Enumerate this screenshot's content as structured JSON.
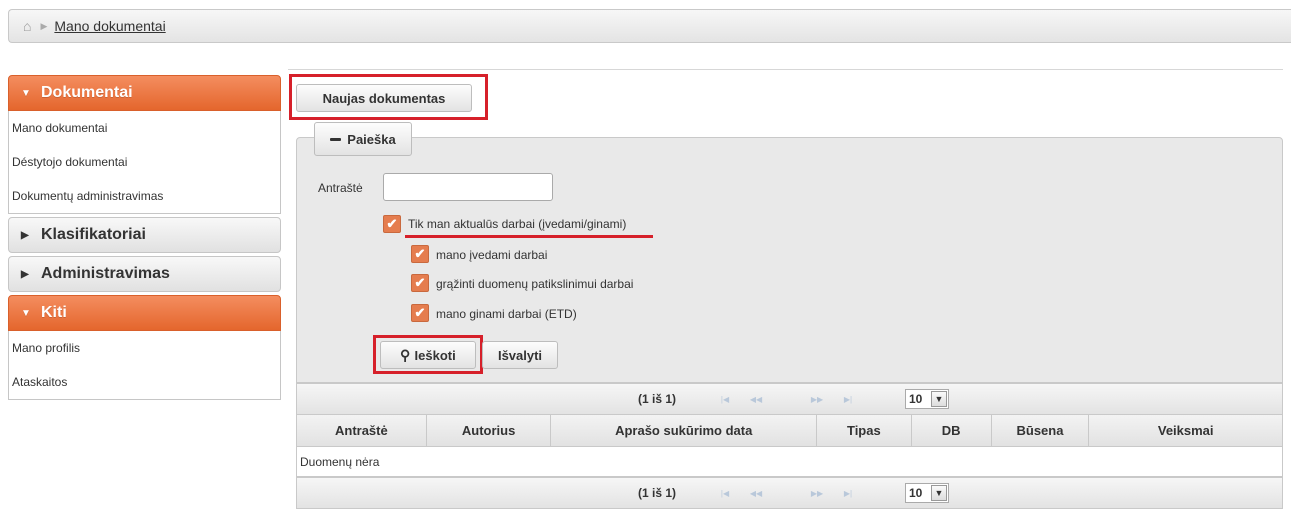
{
  "breadcrumb": {
    "current": "Mano dokumentai"
  },
  "sidebar": {
    "sections": [
      {
        "title": "Dokumentai",
        "items": [
          "Mano dokumentai",
          "Déstytojo dokumentai",
          "Dokumentų administravimas"
        ]
      },
      {
        "title": "Klasifikatoriai"
      },
      {
        "title": "Administravimas"
      },
      {
        "title": "Kiti",
        "items": [
          "Mano profilis",
          "Ataskaitos"
        ]
      }
    ]
  },
  "actions": {
    "new_document": "Naujas dokumentas"
  },
  "search": {
    "legend": "Paieška",
    "title_label": "Antraštė",
    "title_value": "",
    "only_relevant": "Tik man aktualūs darbai (įvedami/ginami)",
    "my_entered": "mano įvedami darbai",
    "returned": "grąžinti duomenų patikslinimui darbai",
    "my_defended": "mano ginami darbai (ETD)",
    "search_button": "Ieškoti",
    "clear_button": "Išvalyti"
  },
  "table": {
    "pager_text": "(1 iš 1)",
    "page_size": "10",
    "columns": [
      "Antraštė",
      "Autorius",
      "Aprašo sukūrimo data",
      "Tipas",
      "DB",
      "Būsena",
      "Veiksmai"
    ],
    "empty_message": "Duomenų nėra"
  },
  "colors": {
    "accent": "#e57d4f",
    "highlight": "#d6202a"
  }
}
